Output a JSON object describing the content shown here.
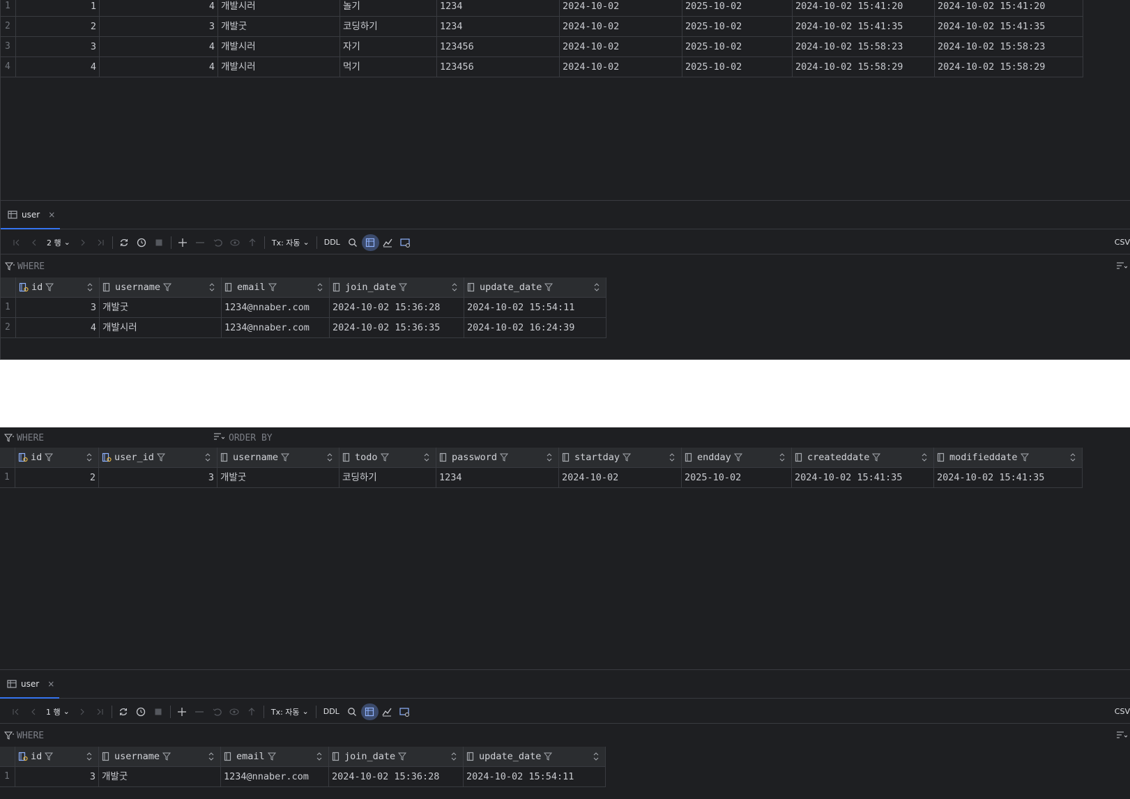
{
  "todo_columns": [
    "id",
    "user_id",
    "username",
    "todo",
    "password",
    "startday",
    "endday",
    "createddate",
    "modifieddate"
  ],
  "user_columns": [
    "id",
    "username",
    "email",
    "join_date",
    "update_date"
  ],
  "top_todo_rows": [
    {
      "rn": "1",
      "id": "1",
      "user_id": "4",
      "username": "개발시러",
      "todo": "놀기",
      "password": "1234",
      "startday": "2024-10-02",
      "endday": "2025-10-02",
      "createddate": "2024-10-02 15:41:20",
      "modifieddate": "2024-10-02 15:41:20"
    },
    {
      "rn": "2",
      "id": "2",
      "user_id": "3",
      "username": "개발굿",
      "todo": "코딩하기",
      "password": "1234",
      "startday": "2024-10-02",
      "endday": "2025-10-02",
      "createddate": "2024-10-02 15:41:35",
      "modifieddate": "2024-10-02 15:41:35"
    },
    {
      "rn": "3",
      "id": "3",
      "user_id": "4",
      "username": "개발시러",
      "todo": "자기",
      "password": "123456",
      "startday": "2024-10-02",
      "endday": "2025-10-02",
      "createddate": "2024-10-02 15:58:23",
      "modifieddate": "2024-10-02 15:58:23"
    },
    {
      "rn": "4",
      "id": "4",
      "user_id": "4",
      "username": "개발시러",
      "todo": "먹기",
      "password": "123456",
      "startday": "2024-10-02",
      "endday": "2025-10-02",
      "createddate": "2024-10-02 15:58:29",
      "modifieddate": "2024-10-02 15:58:29"
    }
  ],
  "panel1": {
    "tab_label": "user",
    "tab_close": "×",
    "row_count": "2 행",
    "tx_label": "Tx: 자동",
    "ddl_label": "DDL",
    "csv_label": "CSV",
    "where_label": "WHERE",
    "user_rows": [
      {
        "rn": "1",
        "id": "3",
        "username": "개발굿",
        "email": "1234@nnaber.com",
        "join_date": "2024-10-02 15:36:28",
        "update_date": "2024-10-02 15:54:11"
      },
      {
        "rn": "2",
        "id": "4",
        "username": "개발시러",
        "email": "1234@nnaber.com",
        "join_date": "2024-10-02 15:36:35",
        "update_date": "2024-10-02 16:24:39"
      }
    ]
  },
  "panel2": {
    "where_label": "WHERE",
    "orderby_label": "ORDER BY",
    "todo_rows": [
      {
        "rn": "1",
        "id": "2",
        "user_id": "3",
        "username": "개발굿",
        "todo": "코딩하기",
        "password": "1234",
        "startday": "2024-10-02",
        "endday": "2025-10-02",
        "createddate": "2024-10-02 15:41:35",
        "modifieddate": "2024-10-02 15:41:35"
      }
    ],
    "tab_label": "user",
    "tab_close": "×",
    "row_count": "1 행",
    "tx_label": "Tx: 자동",
    "ddl_label": "DDL",
    "csv_label": "CSV",
    "user_where_label": "WHERE",
    "user_rows": [
      {
        "rn": "1",
        "id": "3",
        "username": "개발굿",
        "email": "1234@nnaber.com",
        "join_date": "2024-10-02 15:36:28",
        "update_date": "2024-10-02 15:54:11"
      }
    ]
  },
  "colors": {
    "accent": "#3574f0",
    "panel_bg": "#1e1f22",
    "header_bg": "#2b2d30"
  },
  "icons": [
    "table-icon",
    "first-page-icon",
    "prev-page-icon",
    "next-page-icon",
    "last-page-icon",
    "refresh-icon",
    "history-icon",
    "stop-icon",
    "add-row-icon",
    "delete-row-icon",
    "revert-icon",
    "preview-icon",
    "submit-icon",
    "search-icon",
    "grid-view-icon",
    "chart-icon",
    "settings-view-icon",
    "filter-icon",
    "sort-icon",
    "key-column-icon",
    "column-icon"
  ]
}
